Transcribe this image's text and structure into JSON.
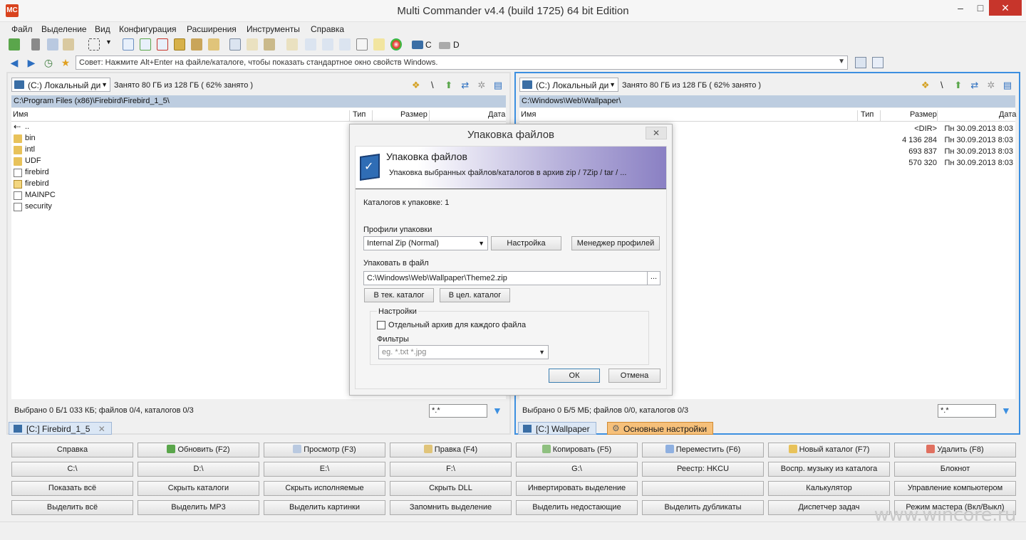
{
  "window": {
    "title": "Multi Commander v4.4 (build 1725) 64 bit Edition",
    "icon_label": "MC",
    "min_glyph": "–",
    "max_glyph": "□",
    "close_glyph": "✕"
  },
  "menu": [
    "Файл",
    "Выделение",
    "Вид",
    "Конфигурация",
    "Расширения",
    "Инструменты",
    "Справка"
  ],
  "toolbar": {
    "drive_c": "C",
    "drive_d": "D"
  },
  "address": {
    "hint": "Совет: Нажмите Alt+Enter на файле/каталоге, чтобы показать стандартное окно свойств Windows.",
    "back_glyph": "◀",
    "forward_glyph": "▶",
    "arrow_glyph": "▼"
  },
  "left_panel": {
    "drive": "(C:) Локальный ди",
    "space": "Занято 80 ГБ из 128 ГБ ( 62% занято )",
    "path": "C:\\Program Files (x86)\\Firebird\\Firebird_1_5\\",
    "columns": {
      "name": "Имя",
      "type": "Тип",
      "size": "Размер",
      "date": "Дата"
    },
    "files": [
      {
        "name": "..",
        "icon": "up-icon"
      },
      {
        "name": "bin",
        "icon": "folder-icon"
      },
      {
        "name": "intl",
        "icon": "folder-icon"
      },
      {
        "name": "UDF",
        "icon": "folder-icon"
      },
      {
        "name": "firebird",
        "icon": "file-icon"
      },
      {
        "name": "firebird",
        "icon": "mail-icon"
      },
      {
        "name": "MAINPC",
        "icon": "file-icon"
      },
      {
        "name": "security",
        "icon": "file-icon"
      }
    ],
    "status": "Выбрано 0 Б/1 033 КБ; файлов 0/4, каталогов 0/3",
    "filter": "*.*",
    "tab": "[C:] Firebird_1_5"
  },
  "right_panel": {
    "drive": "(C:) Локальный ди",
    "space": "Занято 80 ГБ из 128 ГБ ( 62% занято )",
    "path": "C:\\Windows\\Web\\Wallpaper\\",
    "columns": {
      "name": "Имя",
      "type": "Тип",
      "size": "Размер",
      "date": "Дата"
    },
    "files": [
      {
        "size": "<DIR>",
        "date": "Пн 30.09.2013 8:03"
      },
      {
        "size": "4 136 284",
        "date": "Пн 30.09.2013 8:03"
      },
      {
        "size": "693 837",
        "date": "Пн 30.09.2013 8:03"
      },
      {
        "size": "570 320",
        "date": "Пн 30.09.2013 8:03"
      }
    ],
    "status": "Выбрано 0 Б/5 МБ; файлов 0/0, каталогов 0/3",
    "filter": "*.*",
    "tab": "[C:] Wallpaper",
    "tab2": "Основные настройки"
  },
  "dialog": {
    "title": "Упаковка файлов",
    "close_glyph": "✕",
    "banner_title": "Упаковка файлов",
    "banner_sub": "Упаковка выбранных файлов/каталогов в архив zip / 7Zip / tar / ...",
    "dirs_count": "Каталогов к упаковке: 1",
    "profiles_label": "Профили упаковки",
    "profile_value": "Internal Zip (Normal)",
    "settings_btn": "Настройка",
    "profile_mgr_btn": "Менеджер профилей",
    "pack_to_label": "Упаковать в файл",
    "pack_to_value": "C:\\Windows\\Web\\Wallpaper\\Theme2.zip",
    "browse_btn": "...",
    "cur_dir_btn": "В тек. каталог",
    "target_dir_btn": "В цел. каталог",
    "group_label": "Настройки",
    "separate_archive": "Отдельный архив для каждого файла",
    "filters_label": "Фильтры",
    "filters_placeholder": "eg. *.txt *.jpg",
    "ok": "ОК",
    "cancel": "Отмена"
  },
  "buttons": [
    [
      "Справка",
      "Обновить (F2)",
      "Просмотр (F3)",
      "Правка (F4)",
      "Копировать (F5)",
      "Переместить (F6)",
      "Новый каталог (F7)",
      "Удалить (F8)"
    ],
    [
      "C:\\",
      "D:\\",
      "E:\\",
      "F:\\",
      "G:\\",
      "Реестр: HKCU",
      "Воспр. музыку из каталога",
      "Блокнот"
    ],
    [
      "Показать всё",
      "Скрыть каталоги",
      "Скрыть исполняемые",
      "Скрыть DLL",
      "Инвертировать выделение",
      "",
      "Калькулятор",
      "Управление компьютером"
    ],
    [
      "Выделить всё",
      "Выделить MP3",
      "Выделить картинки",
      "Запомнить выделение",
      "Выделить недостающие",
      "Выделить дубликаты",
      "Диспетчер задач",
      "Режим мастера (Вкл/Выкл)"
    ]
  ],
  "watermark": "www.wincore.ru",
  "colors": {
    "accent": "#3c8fe0",
    "path_bg": "#bdcde0",
    "close": "#c7352b"
  }
}
